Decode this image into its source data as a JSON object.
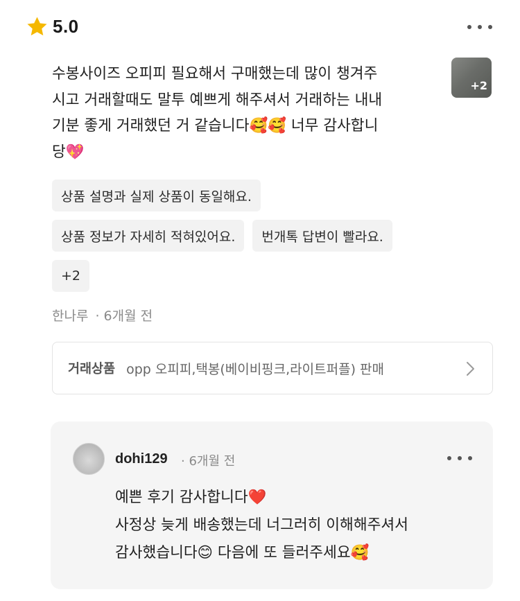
{
  "rating": {
    "value": "5.0",
    "star_color": "#F5B800",
    "star_icon": "star-icon"
  },
  "review": {
    "text": "수봉사이즈 오피피 필요해서 구매했는데 많이 챙겨주\n시고 거래할때도 말투 예쁘게 해주셔서 거래하는 내내\n기분 좋게 거래했던 거 같습니다🥰🥰 너무 감사합니\n당💖",
    "photo_extra_count": "+2",
    "tags": [
      "상품 설명과 실제 상품이 동일해요.",
      "상품 정보가 자세히 적혀있어요.",
      "번개톡 답변이 빨라요.",
      "+2"
    ],
    "reviewer": "한나루",
    "time": "6개월 전"
  },
  "trade": {
    "label": "거래상품",
    "item": "opp 오피피,택봉(베이비핑크,라이트퍼플) 판매"
  },
  "reply": {
    "user": "dohi129",
    "time": "6개월 전",
    "text": "예쁜 후기 감사합니다❤️\n사정상 늦게 배송했는데 너그러히 이해해주셔서\n감사했습니다😊 다음에 또 들러주세요🥰"
  }
}
